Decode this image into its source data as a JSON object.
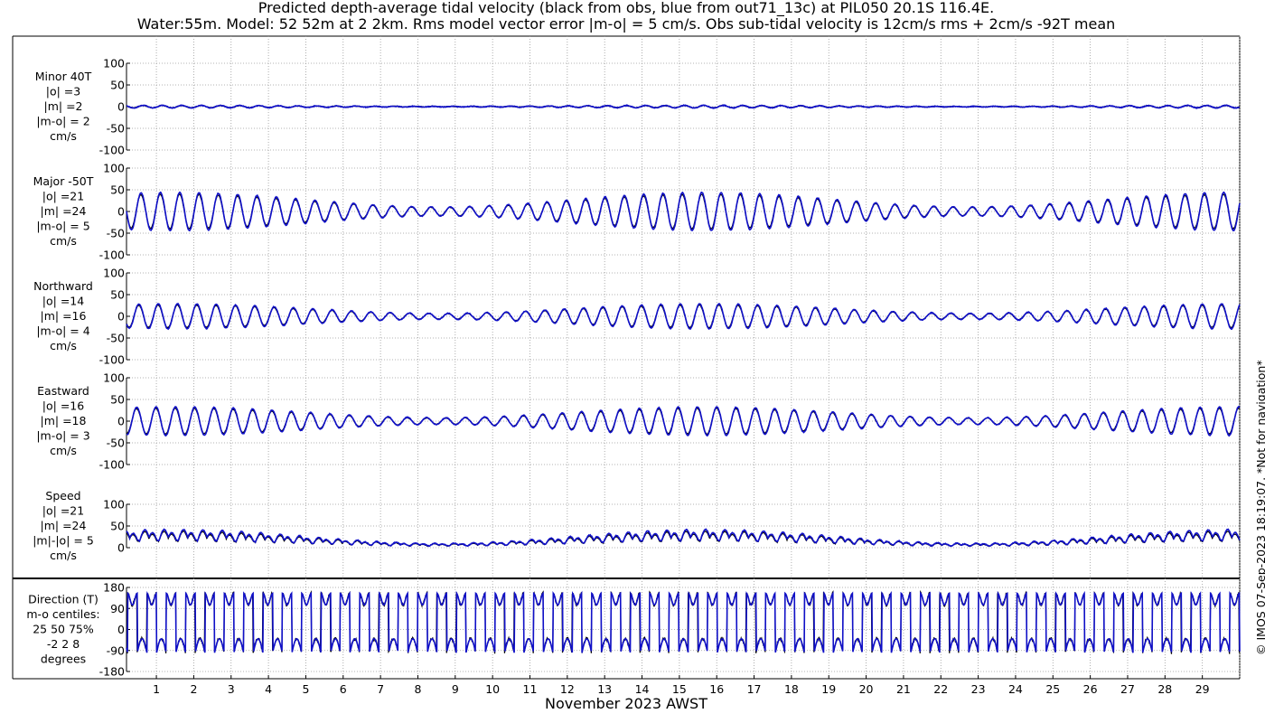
{
  "title": {
    "line1": "Predicted depth-average tidal velocity (black from obs, blue from out71_13c) at PIL050 20.1S 116.4E.",
    "line2": "Water:55m. Model: 52 52m at 2 2km. Rms model vector error |m-o| = 5 cm/s. Obs sub-tidal velocity is 12cm/s rms + 2cm/s -92T mean"
  },
  "xlabel": "November 2023 AWST",
  "copyright": "© IMOS 07-Sep-2023 18:19:07. *Not for navigation*",
  "colors": {
    "model": "#1010c8",
    "obs": "#000000",
    "grid": "#9a9a9a"
  },
  "chart_data": {
    "type": "line",
    "x_ticks": [
      "1",
      "2",
      "3",
      "4",
      "5",
      "6",
      "7",
      "8",
      "9",
      "10",
      "11",
      "12",
      "13",
      "14",
      "15",
      "16",
      "17",
      "18",
      "19",
      "20",
      "21",
      "22",
      "23",
      "24",
      "25",
      "26",
      "27",
      "28",
      "29"
    ],
    "xlim": [
      0.2,
      30.0
    ],
    "series": [
      {
        "name": "obs"
      },
      {
        "name": "model"
      }
    ],
    "panels": [
      {
        "id": "minor",
        "label_lines": [
          "Minor 40T",
          "|o| =3",
          "|m| =2",
          "|m-o| = 2",
          "cm/s"
        ],
        "ylim": [
          -100,
          100
        ],
        "yticks": [
          "100",
          "50",
          "0",
          "-50",
          "-100"
        ],
        "amplitude": 3,
        "type": "semidiurnal"
      },
      {
        "id": "major",
        "label_lines": [
          "Major -50T",
          "|o| =21",
          "|m| =24",
          "|m-o| = 5",
          "cm/s"
        ],
        "ylim": [
          -100,
          100
        ],
        "yticks": [
          "100",
          "50",
          "0",
          "-50",
          "-100"
        ],
        "amplitude": 44,
        "type": "semidiurnal"
      },
      {
        "id": "north",
        "label_lines": [
          "Northward",
          "|o| =14",
          "|m| =16",
          "|m-o| = 4",
          "cm/s"
        ],
        "ylim": [
          -100,
          100
        ],
        "yticks": [
          "100",
          "50",
          "0",
          "-50",
          "-100"
        ],
        "amplitude": 29,
        "type": "semidiurnal"
      },
      {
        "id": "east",
        "label_lines": [
          "Eastward",
          "|o| =16",
          "|m| =18",
          "|m-o| = 3",
          "cm/s"
        ],
        "ylim": [
          -100,
          100
        ],
        "yticks": [
          "100",
          "50",
          "0",
          "-50",
          "-100"
        ],
        "amplitude": 33,
        "type": "semidiurnal"
      },
      {
        "id": "speed",
        "label_lines": [
          "Speed",
          "|o| =21",
          "|m| =24",
          "|m|-|o| = 5",
          "cm/s"
        ],
        "ylim": [
          0,
          100
        ],
        "yticks": [
          "100",
          "50",
          "0"
        ],
        "amplitude": 44,
        "type": "speed"
      },
      {
        "id": "direction",
        "label_lines": [
          "Direction (T)",
          "m-o centiles:",
          "25  50  75%",
          "-2  2  8",
          "degrees"
        ],
        "ylim": [
          -180,
          180
        ],
        "yticks": [
          "180",
          "90",
          "0",
          "-90",
          "-180"
        ],
        "type": "direction"
      }
    ]
  }
}
